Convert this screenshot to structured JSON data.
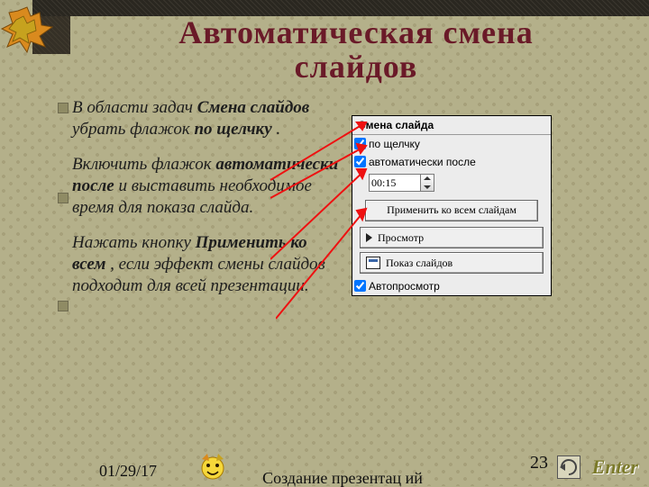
{
  "title_l1": "Автоматическая смена",
  "title_l2": "слайдов",
  "bullets": [
    {
      "pre": "В области задач ",
      "b1": "Смена слайдов",
      "mid": "  убрать флажок ",
      "b2": "по щелчку",
      "post": "."
    },
    {
      "pre": "Включить флажок ",
      "b1": "автоматически после",
      "mid": " и выставить необходимое время для показа слайда.",
      "b2": "",
      "post": ""
    },
    {
      "pre": "Нажать кнопку ",
      "b1": "Применить ко всем",
      "mid": ", если эффект смены слайдов подходит для всей презентации.",
      "b2": "",
      "post": ""
    }
  ],
  "panel": {
    "title": "Смена слайда",
    "cb1": "по щелчку",
    "cb2": "автоматически после",
    "time": "00:15",
    "apply": "Применить ко всем слайдам",
    "preview": "Просмотр",
    "show": "Показ слайдов",
    "auto": "Автопросмотр"
  },
  "footer": {
    "date": "01/29/17",
    "center": "Создание презентац ий",
    "page": "23",
    "enter": "Enter"
  }
}
